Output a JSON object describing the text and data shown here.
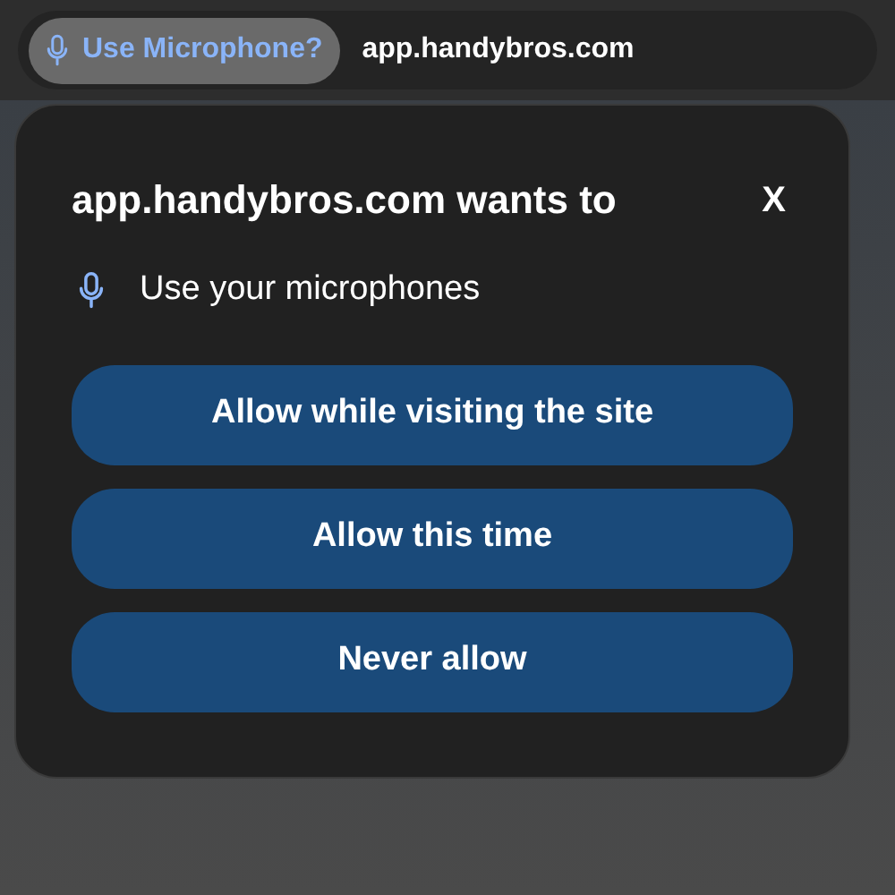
{
  "toolbar": {
    "permission_chip": "Use Microphone?",
    "url": "app.handybros.com"
  },
  "dialog": {
    "title": "app.handybros.com wants to",
    "close": "X",
    "permission": "Use your microphones",
    "buttons": [
      "Allow while visiting the site",
      "Allow this time",
      "Never allow"
    ]
  }
}
